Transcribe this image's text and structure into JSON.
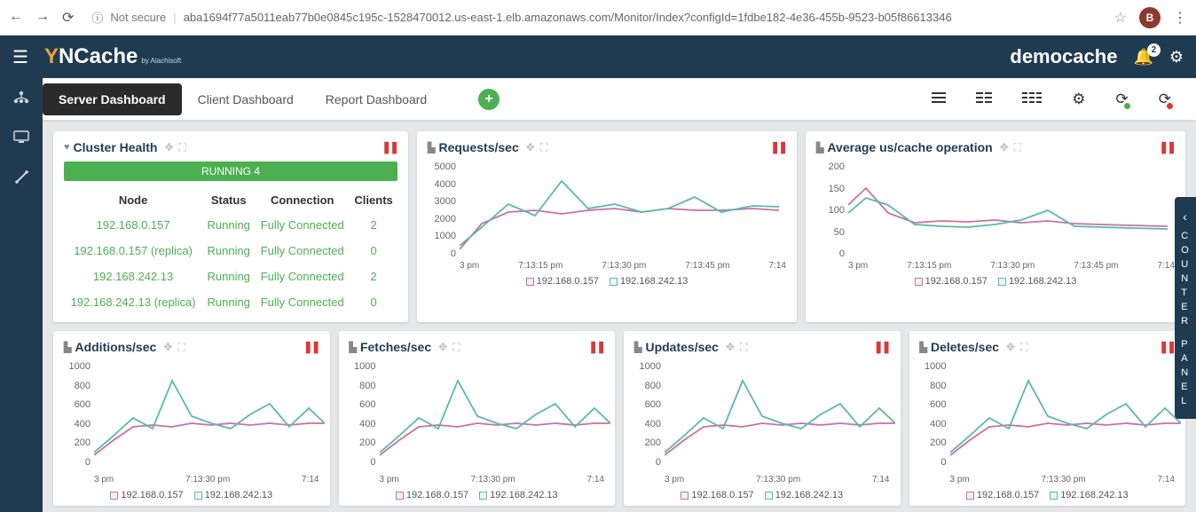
{
  "browser": {
    "secure_label": "Not secure",
    "url": "aba1694f77a5011eab77b0e0845c195c-1528470012.us-east-1.elb.amazonaws.com/Monitor/Index?configId=1fdbe182-4e36-455b-9523-b05f86613346",
    "avatar": "B"
  },
  "header": {
    "brand": "NCache",
    "brand_sub": "by Alachisoft",
    "cache_name": "democache",
    "bell_count": "2"
  },
  "tabs": {
    "server": "Server Dashboard",
    "client": "Client Dashboard",
    "report": "Report Dashboard"
  },
  "cluster": {
    "title": "Cluster Health",
    "banner": "RUNNING 4",
    "cols": {
      "node": "Node",
      "status": "Status",
      "conn": "Connection",
      "clients": "Clients"
    },
    "r0": {
      "node": "192.168.0.157",
      "status": "Running",
      "conn": "Fully Connected",
      "clients": "2"
    },
    "r1": {
      "node": "192.168.0.157 (replica)",
      "status": "Running",
      "conn": "Fully Connected",
      "clients": "0"
    },
    "r2": {
      "node": "192.168.242.13",
      "status": "Running",
      "conn": "Fully Connected",
      "clients": "2"
    },
    "r3": {
      "node": "192.168.242.13 (replica)",
      "status": "Running",
      "conn": "Fully Connected",
      "clients": "0"
    }
  },
  "legend": {
    "a": "192.168.0.157",
    "b": "192.168.242.13"
  },
  "charts": {
    "req": {
      "title": "Requests/sec",
      "y": [
        "5000",
        "4000",
        "3000",
        "2000",
        "1000",
        "0"
      ],
      "x": [
        "3 pm",
        "7:13:15 pm",
        "7:13:30 pm",
        "7:13:45 pm",
        "7:14"
      ]
    },
    "avg": {
      "title": "Average us/cache operation",
      "y": [
        "200",
        "150",
        "100",
        "50",
        "0"
      ],
      "x": [
        "3 pm",
        "7:13:15 pm",
        "7:13:30 pm",
        "7:13:45 pm",
        "7:14"
      ]
    },
    "add": {
      "title": "Additions/sec",
      "y": [
        "1000",
        "800",
        "600",
        "400",
        "200",
        "0"
      ],
      "x": [
        "3 pm",
        "7:13:30 pm",
        "7:14"
      ]
    },
    "fet": {
      "title": "Fetches/sec",
      "y": [
        "1000",
        "800",
        "600",
        "400",
        "200",
        "0"
      ],
      "x": [
        "3 pm",
        "7:13:30 pm",
        "7:14"
      ]
    },
    "upd": {
      "title": "Updates/sec",
      "y": [
        "1000",
        "800",
        "600",
        "400",
        "200",
        "0"
      ],
      "x": [
        "3 pm",
        "7:13:30 pm",
        "7:14"
      ]
    },
    "del": {
      "title": "Deletes/sec",
      "y": [
        "1000",
        "800",
        "600",
        "400",
        "200",
        "0"
      ],
      "x": [
        "3 pm",
        "7:13:30 pm",
        "7:14"
      ]
    }
  },
  "chart_data": [
    {
      "type": "line",
      "title": "Requests/sec",
      "ylim": [
        0,
        5000
      ],
      "x": [
        "7:13:00",
        "7:13:15",
        "7:13:30",
        "7:13:45",
        "7:14:00"
      ],
      "series": [
        {
          "name": "192.168.0.157",
          "values": [
            500,
            1800,
            2400,
            2500,
            2300,
            2500,
            2600,
            2400,
            2600,
            2500,
            2500,
            2600
          ]
        },
        {
          "name": "192.168.242.13",
          "values": [
            700,
            1600,
            2800,
            2200,
            4000,
            2600,
            2800,
            2400,
            2600,
            3200,
            2400,
            2700
          ]
        }
      ]
    },
    {
      "type": "line",
      "title": "Average us/cache operation",
      "ylim": [
        0,
        200
      ],
      "x": [
        "7:13:00",
        "7:13:15",
        "7:13:30",
        "7:13:45",
        "7:14:00"
      ],
      "series": [
        {
          "name": "192.168.0.157",
          "values": [
            110,
            145,
            95,
            75,
            78,
            76,
            80,
            75,
            78,
            74,
            72,
            70
          ]
        },
        {
          "name": "192.168.242.13",
          "values": [
            95,
            125,
            110,
            72,
            70,
            68,
            72,
            80,
            100,
            70,
            68,
            66
          ]
        }
      ]
    },
    {
      "type": "line",
      "title": "Additions/sec",
      "ylim": [
        0,
        1000
      ],
      "series": [
        {
          "name": "192.168.0.157",
          "values": [
            120,
            260,
            380,
            400,
            380,
            420,
            400,
            420,
            400,
            420,
            400,
            420
          ]
        },
        {
          "name": "192.168.242.13",
          "values": [
            140,
            300,
            460,
            360,
            820,
            480,
            420,
            360,
            500,
            600,
            380,
            560
          ]
        }
      ]
    },
    {
      "type": "line",
      "title": "Fetches/sec",
      "ylim": [
        0,
        1000
      ],
      "series": [
        {
          "name": "192.168.0.157",
          "values": [
            120,
            260,
            380,
            400,
            380,
            420,
            400,
            420,
            400,
            420,
            400,
            420
          ]
        },
        {
          "name": "192.168.242.13",
          "values": [
            140,
            300,
            460,
            360,
            820,
            480,
            420,
            360,
            500,
            600,
            380,
            560
          ]
        }
      ]
    },
    {
      "type": "line",
      "title": "Updates/sec",
      "ylim": [
        0,
        1000
      ],
      "series": [
        {
          "name": "192.168.0.157",
          "values": [
            120,
            260,
            380,
            400,
            380,
            420,
            400,
            420,
            400,
            420,
            400,
            420
          ]
        },
        {
          "name": "192.168.242.13",
          "values": [
            140,
            300,
            460,
            360,
            820,
            480,
            420,
            360,
            500,
            600,
            380,
            560
          ]
        }
      ]
    },
    {
      "type": "line",
      "title": "Deletes/sec",
      "ylim": [
        0,
        1000
      ],
      "series": [
        {
          "name": "192.168.0.157",
          "values": [
            120,
            260,
            380,
            400,
            380,
            420,
            400,
            420,
            400,
            420,
            400,
            420
          ]
        },
        {
          "name": "192.168.242.13",
          "values": [
            140,
            300,
            460,
            360,
            820,
            480,
            420,
            360,
            500,
            600,
            380,
            560
          ]
        }
      ]
    }
  ],
  "counter_panel": "COUNTER PANEL"
}
